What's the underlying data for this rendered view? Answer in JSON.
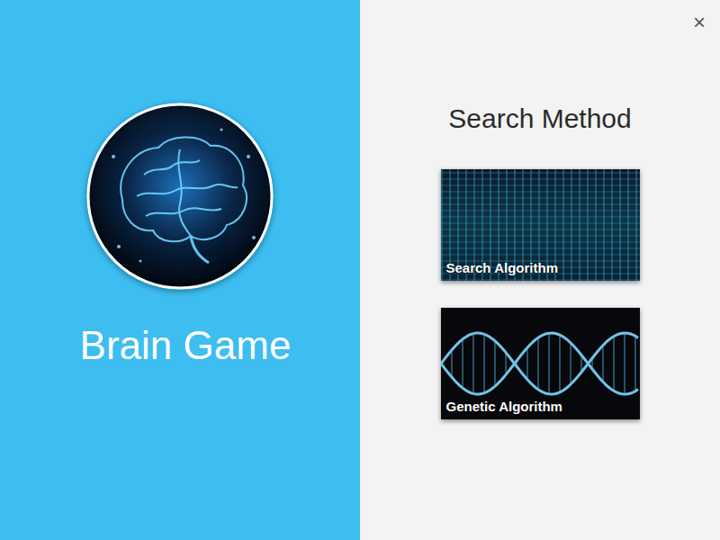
{
  "app": {
    "title": "Brain Game"
  },
  "close_button": "×",
  "panel": {
    "heading": "Search Method"
  },
  "methods": [
    {
      "label": "Search Algorithm",
      "kind": "grid"
    },
    {
      "label": "Genetic Algorithm",
      "kind": "dna"
    }
  ]
}
